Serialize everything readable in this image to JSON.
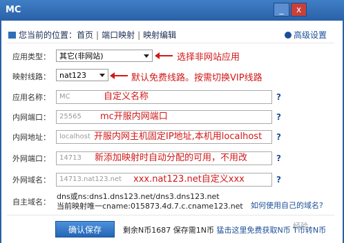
{
  "window": {
    "title": "MC",
    "min_label": "_",
    "close_label": "x"
  },
  "breadcrumb": {
    "prefix": "您当前的位置：",
    "items": [
      "首页",
      "端口映射",
      "映射编辑"
    ],
    "sep": "|"
  },
  "advanced": "高级设置",
  "fields": {
    "app_type": {
      "label": "应用类型：",
      "value": "其它(非网站)"
    },
    "line": {
      "label": "映射线路：",
      "value": "nat123"
    },
    "app_name": {
      "label": "应用名称：",
      "value": "MC"
    },
    "lan_port": {
      "label": "内网端口：",
      "value": "25565"
    },
    "lan_addr": {
      "label": "内网地址：",
      "value": "localhost"
    },
    "wan_port": {
      "label": "外网端口：",
      "value": "14713"
    },
    "wan_domain": {
      "label": "外网域名：",
      "value": "14713.nat123.net"
    },
    "custom_domain": {
      "label": "自主域名："
    }
  },
  "help_mark": "?",
  "dns": {
    "line1": "dns或ns:dns1.dns123.net/dns3.dns123.net",
    "line2": "当前映射唯一cname:015873.4d.7.c.cname123.net"
  },
  "howto_link": "如何使用自己的域名?",
  "annotations": {
    "app_type": "选择非网站应用",
    "line": "默认免费线路。按需切换VIP线路",
    "app_name": "自定义名称",
    "lan_port": "mc开服内网端口",
    "lan_addr": "开服内网主机固定IP地址,本机用localhost",
    "wan_port": "新添加映射时自动分配的可用，不用改",
    "wan_domain": "xxx.nat123.net自定义xxx"
  },
  "save_button": "确认保存",
  "bottom": {
    "balance": "剩余N币1687 保存需1N币",
    "link": "猛击这里免费获取N币 T币转N币"
  },
  "watermark": "经验",
  "colors": {
    "accent": "#2a61a8",
    "annotation": "#d01818",
    "link": "#1b4e96"
  }
}
